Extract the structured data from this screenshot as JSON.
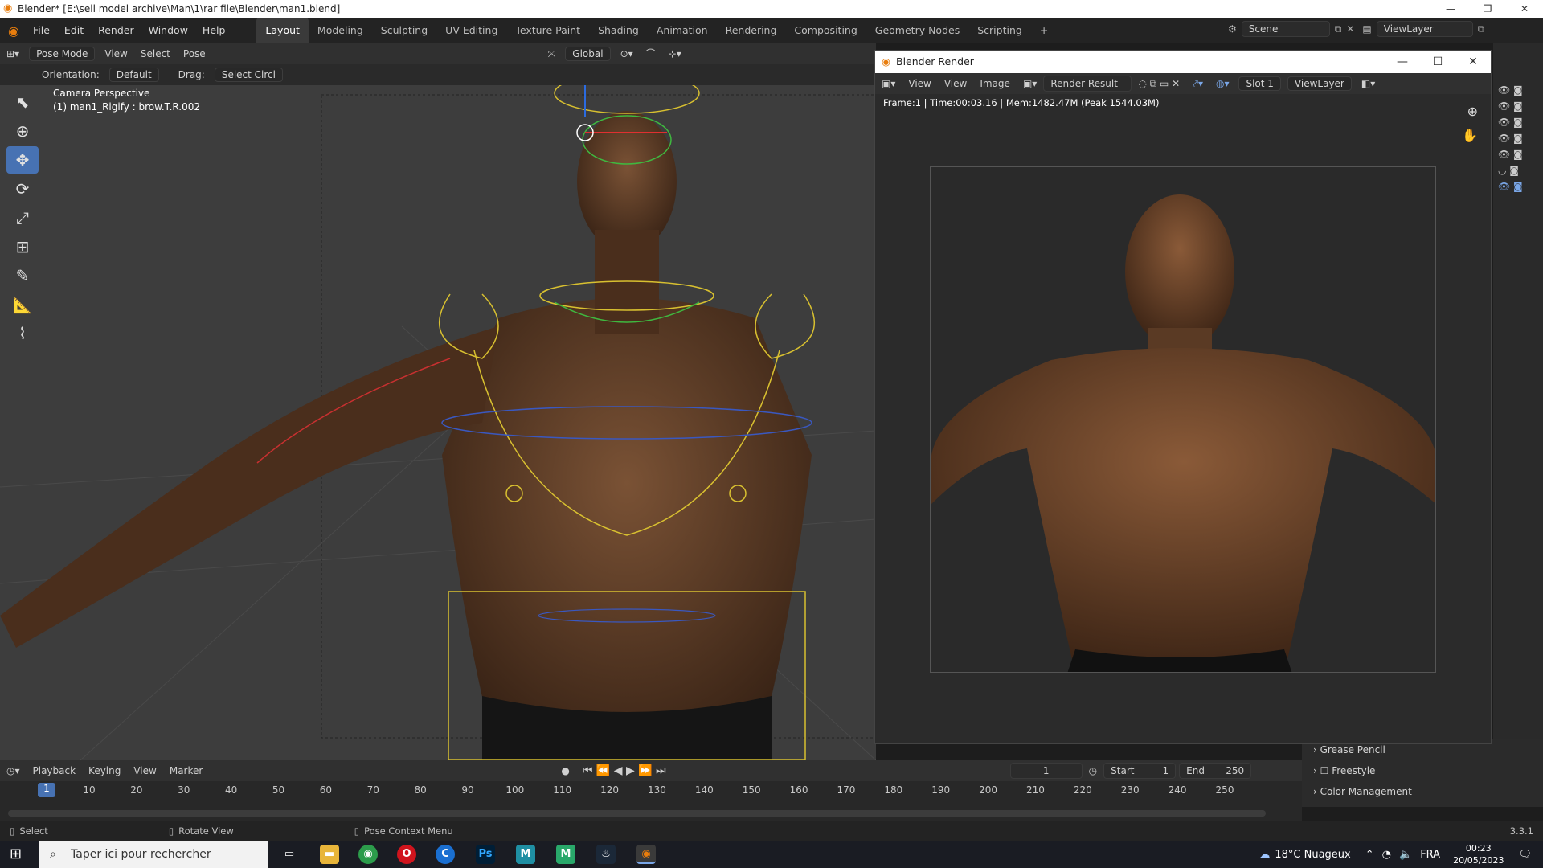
{
  "os": {
    "window_title": "Blender* [E:\\sell model archive\\Man\\1\\rar file\\Blender\\man1.blend]",
    "minimize": "—",
    "restore": "❐",
    "close": "✕"
  },
  "menu": [
    "File",
    "Edit",
    "Render",
    "Window",
    "Help"
  ],
  "workspaces": [
    "Layout",
    "Modeling",
    "Sculpting",
    "UV Editing",
    "Texture Paint",
    "Shading",
    "Animation",
    "Rendering",
    "Compositing",
    "Geometry Nodes",
    "Scripting"
  ],
  "workspace_add": "+",
  "scene": {
    "scene_name": "Scene",
    "view_layer": "ViewLayer"
  },
  "viewport_header": {
    "mode": "Pose Mode",
    "items": [
      "View",
      "Select",
      "Pose"
    ],
    "transform_orientation": "Global",
    "orientation_label": "Orientation:",
    "orientation_value": "Default",
    "drag_label": "Drag:",
    "drag_value": "Select Circl"
  },
  "viewport": {
    "perspective": "Camera Perspective",
    "active_object": "(1) man1_Rigify : brow.T.R.002"
  },
  "render_window": {
    "title": "Blender Render",
    "header_items": [
      "View",
      "View",
      "Image"
    ],
    "image_name": "Render Result",
    "slot": "Slot 1",
    "view_layer": "ViewLayer",
    "stats": "Frame:1 | Time:00:03.16 | Mem:1482.47M (Peak 1544.03M)"
  },
  "properties": {
    "sections": [
      "Grease Pencil",
      "Freestyle",
      "Color Management"
    ]
  },
  "timeline": {
    "menus": [
      "Playback",
      "Keying",
      "View",
      "Marker"
    ],
    "current_frame": "1",
    "start_label": "Start",
    "start": "1",
    "end_label": "End",
    "end": "250",
    "ticks": [
      "10",
      "20",
      "30",
      "40",
      "50",
      "60",
      "70",
      "80",
      "90",
      "100",
      "110",
      "120",
      "130",
      "140",
      "150",
      "160",
      "170",
      "180",
      "190",
      "200",
      "210",
      "220",
      "230",
      "240",
      "250"
    ]
  },
  "statusbar": {
    "select": "Select",
    "rotate": "Rotate View",
    "context": "Pose Context Menu",
    "version": "3.3.1"
  },
  "taskbar": {
    "search_placeholder": "Taper ici pour rechercher",
    "weather": "18°C Nuageux",
    "language": "FRA",
    "time": "00:23",
    "date": "20/05/2023"
  }
}
